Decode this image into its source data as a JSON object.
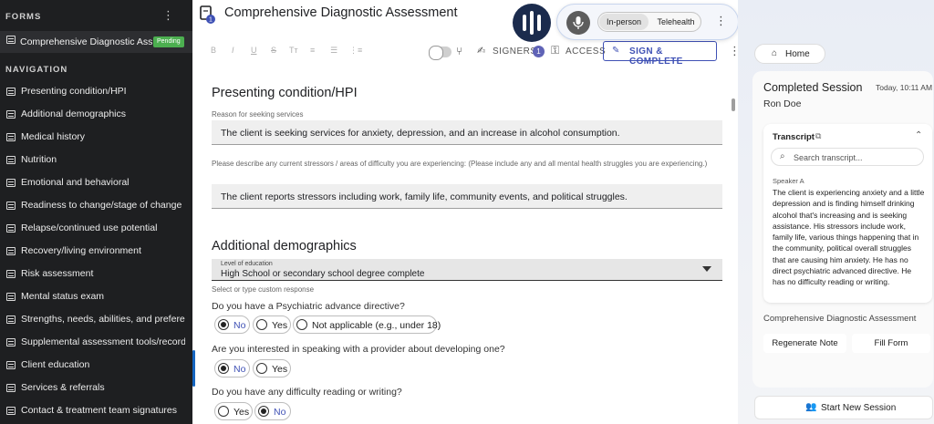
{
  "sidebar": {
    "forms_heading": "FORMS",
    "active_form": {
      "label": "Comprehensive Diagnostic Ass…",
      "badge": "Pending"
    },
    "navigation_heading": "NAVIGATION",
    "items": [
      {
        "label": "Presenting condition/HPI"
      },
      {
        "label": "Additional demographics"
      },
      {
        "label": "Medical history"
      },
      {
        "label": "Nutrition"
      },
      {
        "label": "Emotional and behavioral"
      },
      {
        "label": "Readiness to change/stage of change"
      },
      {
        "label": "Relapse/continued use potential"
      },
      {
        "label": "Recovery/living environment"
      },
      {
        "label": "Risk assessment"
      },
      {
        "label": "Mental status exam"
      },
      {
        "label": "Strengths, needs, abilities, and prefere…"
      },
      {
        "label": "Supplemental assessment tools/records"
      },
      {
        "label": "Client education"
      },
      {
        "label": "Services & referrals"
      },
      {
        "label": "Contact & treatment team signatures"
      }
    ]
  },
  "header": {
    "title": "Comprehensive Diagnostic Assessment",
    "form_icon_badge": "1"
  },
  "toolbar": {
    "format_buttons": [
      "B",
      "I",
      "U",
      "S",
      "Tт",
      "≡",
      "☰",
      "⋮≡"
    ],
    "signers_label": "SIGNERS",
    "signers_count": "1",
    "access_label": "ACCESS",
    "sign_label": "SIGN & COMPLETE"
  },
  "recorder": {
    "mode_in_person": "In-person",
    "mode_telehealth": "Telehealth",
    "selected_mode": "In-person"
  },
  "form": {
    "section1_title": "Presenting condition/HPI",
    "reason_label": "Reason for seeking services",
    "reason_value": "The client is seeking services for anxiety, depression, and an increase in alcohol consumption.",
    "stressors_label": "Please describe any current stressors / areas of difficulty you are experiencing: (Please include any and all mental health struggles you are experiencing.)",
    "stressors_value": "The client reports stressors including work, family life, community events, and political struggles.",
    "section2_title": "Additional demographics",
    "education_label": "Level of education",
    "education_value": "High School or secondary school degree complete",
    "education_hint": "Select or type custom response",
    "q1": "Do you have a Psychiatric advance directive?",
    "q1_options": [
      "No",
      "Yes",
      "Not applicable (e.g., under 18)"
    ],
    "q1_selected": "No",
    "q2": "Are you interested in speaking with a provider about developing one?",
    "q2_options": [
      "No",
      "Yes"
    ],
    "q2_selected": "No",
    "q3": "Do you have any difficulty reading or writing?",
    "q3_options": [
      "Yes",
      "No"
    ],
    "q3_selected": "No"
  },
  "right_panel": {
    "home_label": "Home",
    "session_title": "Completed Session",
    "session_time": "Today, 10:11 AM",
    "client_name": "Ron Doe",
    "transcript_title": "Transcript",
    "search_placeholder": "Search transcript...",
    "speaker": "Speaker A",
    "transcript_text": "The client is experiencing anxiety and a little depression and is finding himself drinking alcohol that's increasing and is seeking assistance. His stressors include work, family life, various things happening that in the community, political overall struggles that are causing him anxiety. He has no direct psychiatric advanced directive. He has no difficulty reading or writing.",
    "note_label": "Comprehensive Diagnostic Assessment",
    "regenerate_label": "Regenerate Note",
    "fill_label": "Fill Form",
    "new_session_label": "Start New Session"
  }
}
